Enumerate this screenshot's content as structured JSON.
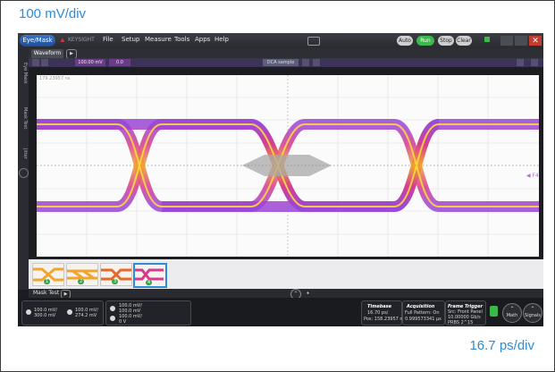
{
  "captions": {
    "vertical_scale": "100 mV/div",
    "horizontal_scale": "16.7 ps/div"
  },
  "menubar": {
    "brand": "Eye/Mask",
    "company": "KEYSIGHT",
    "menus": [
      "File",
      "Setup",
      "Measure",
      "Tools",
      "Apps",
      "Help"
    ],
    "buttons": {
      "auto": "Auto Scale",
      "run": "Run",
      "stop": "Stop",
      "clear": "Clear"
    }
  },
  "sidebar": {
    "tabs": [
      "Eye Mask",
      "Mask Test",
      "Jitter"
    ]
  },
  "waveform_tab": {
    "label": "Waveform",
    "play": "▶"
  },
  "toolbar": {
    "channel_chips": [
      "100.00 mV",
      "0.0"
    ],
    "cursor_chip": "DCA sample"
  },
  "plot": {
    "corner_label": "179.23957 ns",
    "channel_marker": "◀ F4",
    "accent_colors": [
      "#f2a52c",
      "#d63a8c",
      "#9a45d8",
      "#ffd740"
    ]
  },
  "thumbnails": [
    {
      "num": "1",
      "selected": false
    },
    {
      "num": "2",
      "selected": false
    },
    {
      "num": "3",
      "selected": false
    },
    {
      "num": "4",
      "selected": true
    }
  ],
  "mask_test": {
    "label": "Mask Test",
    "play": "▶"
  },
  "status": {
    "ch_group1": {
      "line1": "100.0 mV/",
      "line2": "300.0 mV"
    },
    "ch_group2": {
      "line1": "100.0 mV/",
      "line2": "274.2 mV"
    },
    "ch_group3": {
      "line1": "100.0 mV/",
      "line2": "100.0 mV",
      "line3": "100.0 mV/",
      "line4": "0 V"
    },
    "timebase": {
      "title": "Timebase",
      "line1": "16.70 ps/",
      "line2": "Pos: 158.23957 ns"
    },
    "acquisition": {
      "title": "Acquisition",
      "line1": "Full Pattern: On",
      "line2": "0.999573341 µs"
    },
    "trigger": {
      "title": "Frame Trigger",
      "line1": "Src: Front Panel",
      "line2": "10.00000 Gb/s",
      "line3": "PRBS 2^15"
    },
    "math_label": "Math",
    "signals_label": "Signals"
  }
}
